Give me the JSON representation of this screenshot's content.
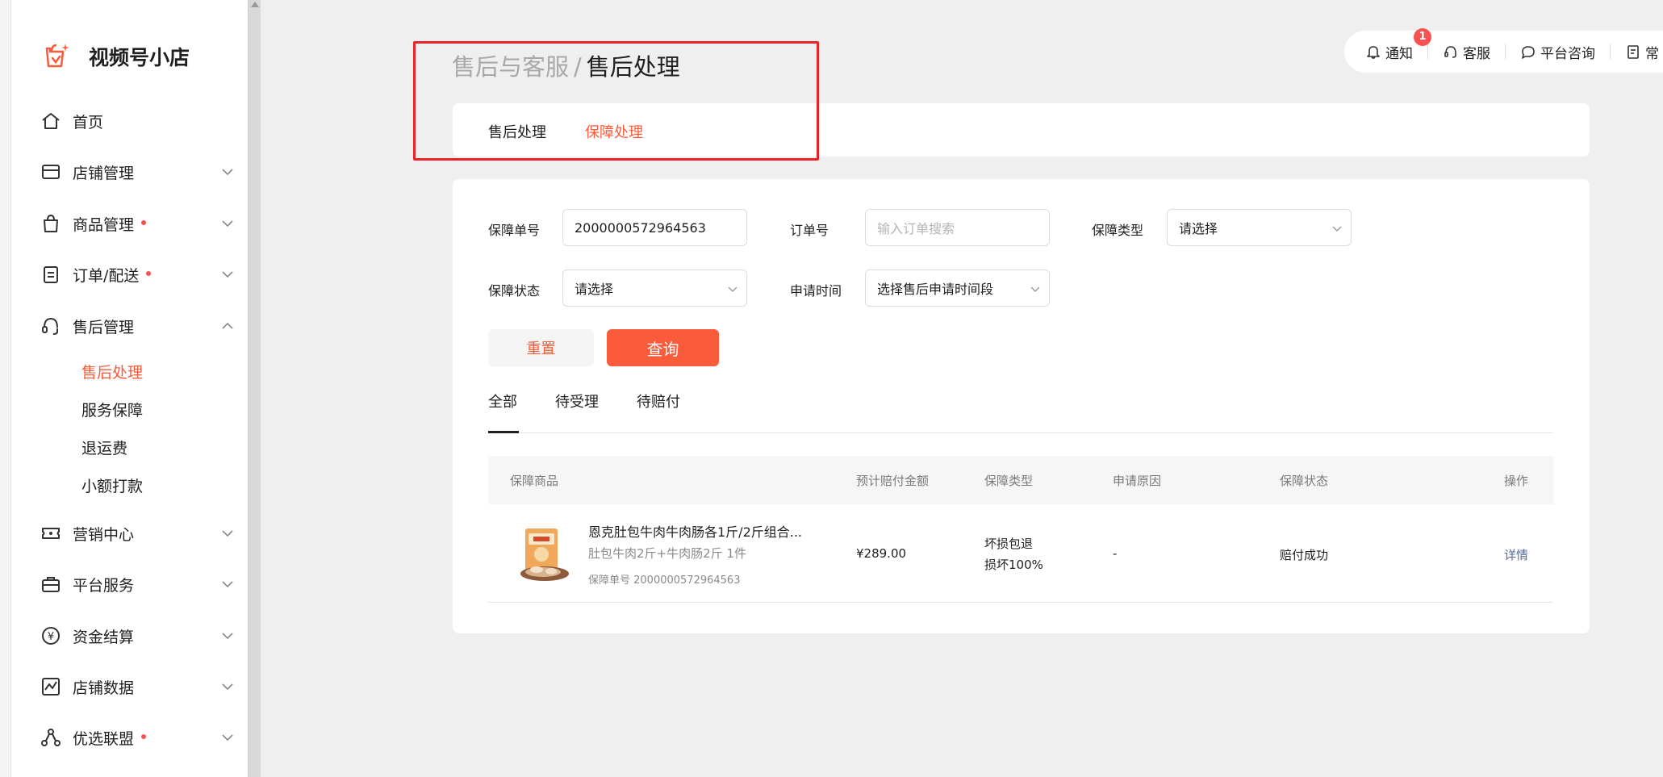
{
  "app": {
    "name": "视频号小店"
  },
  "sidebar": {
    "items": [
      {
        "label": "首页",
        "icon": "home-icon"
      },
      {
        "label": "店铺管理",
        "icon": "store-icon"
      },
      {
        "label": "商品管理",
        "icon": "bag-icon",
        "dot": true
      },
      {
        "label": "订单/配送",
        "icon": "clipboard-icon",
        "dot": true
      },
      {
        "label": "售后管理",
        "icon": "headset-icon",
        "expanded": true
      },
      {
        "label": "营销中心",
        "icon": "ticket-icon"
      },
      {
        "label": "平台服务",
        "icon": "briefcase-icon"
      },
      {
        "label": "资金结算",
        "icon": "yen-icon"
      },
      {
        "label": "店铺数据",
        "icon": "chart-icon"
      },
      {
        "label": "优选联盟",
        "icon": "network-icon",
        "dot": true
      }
    ],
    "sub_items": [
      {
        "label": "售后处理",
        "active": true
      },
      {
        "label": "服务保障"
      },
      {
        "label": "退运费"
      },
      {
        "label": "小额打款"
      }
    ]
  },
  "breadcrumb": {
    "parent": "售后与客服",
    "separator": "/",
    "current": "售后处理"
  },
  "topbar": {
    "notify_label": "通知",
    "notify_count": "1",
    "service_label": "客服",
    "consult_label": "平台咨询",
    "more_label": "常"
  },
  "page_tabs": {
    "items": [
      "售后处理",
      "保障处理"
    ],
    "active_index": 1
  },
  "filters": {
    "guarantee_no_label": "保障单号",
    "guarantee_no_value": "2000000572964563",
    "order_no_label": "订单号",
    "order_no_placeholder": "输入订单搜索",
    "guarantee_type_label": "保障类型",
    "guarantee_type_value": "请选择",
    "guarantee_status_label": "保障状态",
    "guarantee_status_value": "请选择",
    "apply_time_label": "申请时间",
    "apply_time_value": "选择售后申请时间段"
  },
  "buttons": {
    "reset": "重置",
    "query": "查询"
  },
  "status_tabs": {
    "items": [
      "全部",
      "待受理",
      "待赔付"
    ],
    "active_index": 0
  },
  "table": {
    "headers": [
      "保障商品",
      "预计赔付金额",
      "保障类型",
      "申请原因",
      "保障状态",
      "操作"
    ],
    "rows": [
      {
        "product_title": "恩克肚包牛肉牛肉肠各1斤/2斤组合...",
        "product_spec": "肚包牛肉2斤+牛肉肠2斤 1件",
        "guarantee_id": "保障单号 2000000572964563",
        "amount": "¥289.00",
        "type_line1": "坏损包退",
        "type_line2": "损坏100%",
        "reason": "-",
        "status": "赔付成功",
        "action": "详情"
      }
    ]
  },
  "colors": {
    "accent": "#fa5b3a",
    "dot": "#fa5151",
    "link": "#576b95",
    "highlight_box": "#e8242a"
  }
}
